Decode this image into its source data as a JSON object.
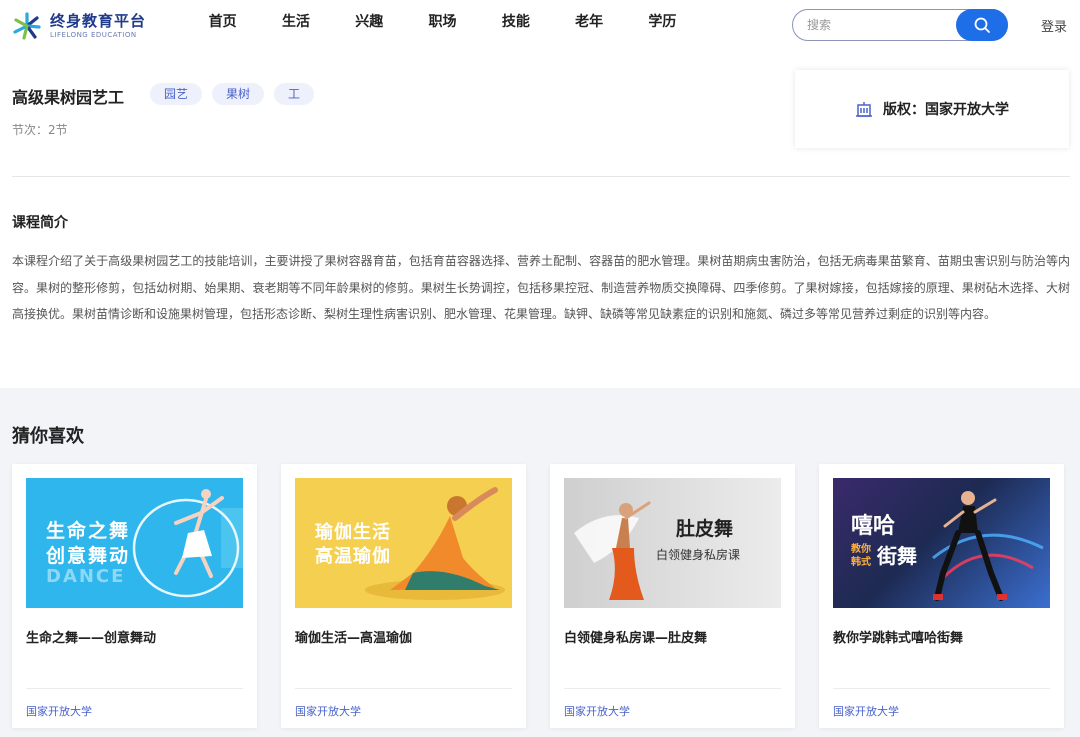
{
  "header": {
    "logo_title": "终身教育平台",
    "logo_subtitle": "LIFELONG EDUCATION",
    "nav": [
      "首页",
      "生活",
      "兴趣",
      "职场",
      "技能",
      "老年",
      "学历"
    ],
    "search_placeholder": "搜索",
    "search_icon": "search-icon",
    "login_label": "登录"
  },
  "course": {
    "title": "高级果树园艺工",
    "tags": [
      "园艺",
      "果树",
      "工"
    ],
    "lessons": "节次：2节",
    "copyright": "版权：国家开放大学",
    "copyright_icon": "building-icon",
    "intro_heading": "课程简介",
    "intro_text": "本课程介绍了关于高级果树园艺工的技能培训，主要讲授了果树容器育苗，包括育苗容器选择、营养土配制、容器苗的肥水管理。果树苗期病虫害防治，包括无病毒果苗繁育、苗期虫害识别与防治等内容。果树的整形修剪，包括幼树期、始果期、衰老期等不同年龄果树的修剪。果树生长势调控，包括移果控冠、制造营养物质交换障碍、四季修剪。了果树嫁接，包括嫁接的原理、果树砧木选择、大树高接换优。果树苗情诊断和设施果树管理，包括形态诊断、梨树生理性病害识别、肥水管理、花果管理。缺钾、缺磷等常见缺素症的识别和施氮、磷过多等常见营养过剩症的识别等内容。"
  },
  "recommend": {
    "heading": "猜你喜欢",
    "cards": [
      {
        "title": "生命之舞——创意舞动",
        "provider": "国家开放大学",
        "thumb_lines": [
          "生命之舞",
          "创意舞动",
          "DANCE"
        ],
        "thumb_bg": "#2fb6ec"
      },
      {
        "title": "瑜伽生活—高温瑜伽",
        "provider": "国家开放大学",
        "thumb_lines": [
          "瑜伽生活",
          "高温瑜伽"
        ],
        "thumb_bg": "#f5cf4f"
      },
      {
        "title": "白领健身私房课—肚皮舞",
        "provider": "国家开放大学",
        "thumb_lines": [
          "肚皮舞",
          "白领健身私房课"
        ],
        "thumb_bg": "#dcdcdc"
      },
      {
        "title": "教你学跳韩式嘻哈街舞",
        "provider": "国家开放大学",
        "thumb_lines": [
          "嘻哈",
          "教你",
          "韩式",
          "街舞"
        ],
        "thumb_bg": "#1d2a52"
      }
    ]
  },
  "colors": {
    "accent": "#1e6ee8",
    "tag_text": "#4a63c9",
    "tag_bg": "#eef1fb",
    "section_bg": "#f2f4f8"
  }
}
